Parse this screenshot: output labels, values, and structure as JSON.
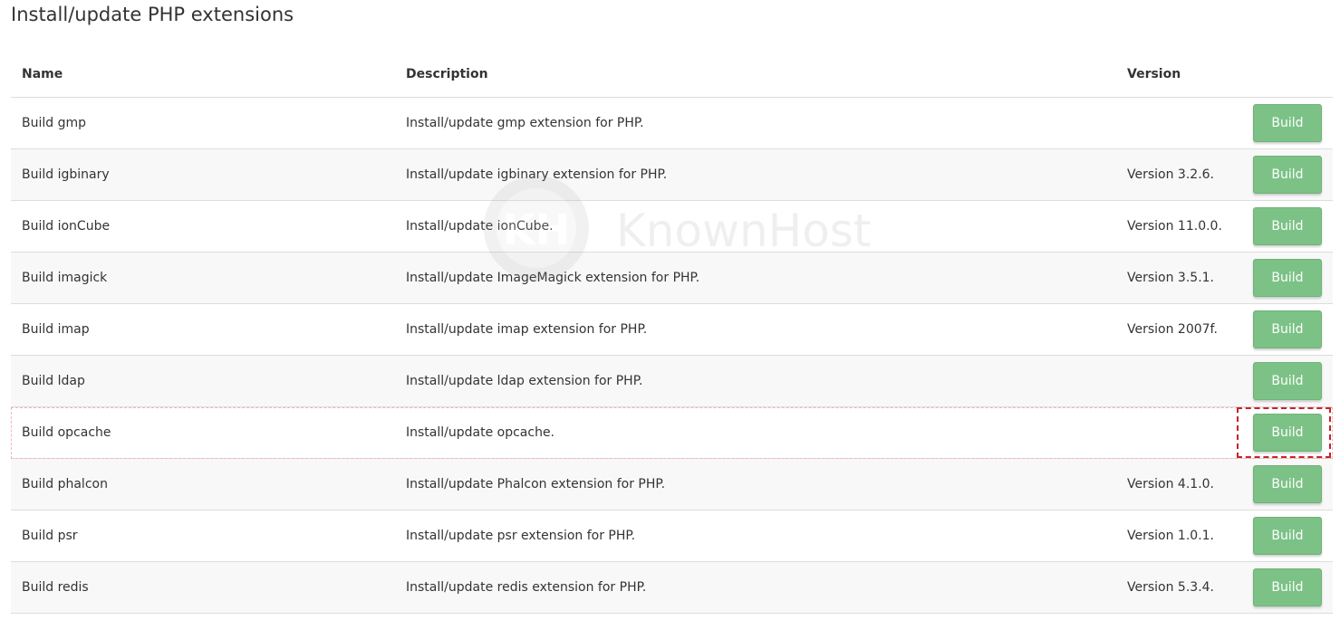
{
  "page": {
    "title": "Install/update PHP extensions"
  },
  "table": {
    "headers": {
      "name": "Name",
      "description": "Description",
      "version": "Version"
    },
    "rows": [
      {
        "name": "Build gmp",
        "description": "Install/update gmp extension for PHP.",
        "version": "",
        "action": "Build"
      },
      {
        "name": "Build igbinary",
        "description": "Install/update igbinary extension for PHP.",
        "version": "Version 3.2.6.",
        "action": "Build"
      },
      {
        "name": "Build ionCube",
        "description": "Install/update ionCube.",
        "version": "Version 11.0.0.",
        "action": "Build"
      },
      {
        "name": "Build imagick",
        "description": "Install/update ImageMagick extension for PHP.",
        "version": "Version 3.5.1.",
        "action": "Build"
      },
      {
        "name": "Build imap",
        "description": "Install/update imap extension for PHP.",
        "version": "Version 2007f.",
        "action": "Build"
      },
      {
        "name": "Build ldap",
        "description": "Install/update ldap extension for PHP.",
        "version": "",
        "action": "Build"
      },
      {
        "name": "Build opcache",
        "description": "Install/update opcache.",
        "version": "",
        "action": "Build",
        "highlighted": true
      },
      {
        "name": "Build phalcon",
        "description": "Install/update Phalcon extension for PHP.",
        "version": "Version 4.1.0.",
        "action": "Build"
      },
      {
        "name": "Build psr",
        "description": "Install/update psr extension for PHP.",
        "version": "Version 1.0.1.",
        "action": "Build"
      },
      {
        "name": "Build redis",
        "description": "Install/update redis extension for PHP.",
        "version": "Version 5.3.4.",
        "action": "Build"
      }
    ]
  },
  "watermark": {
    "monogram": "KH",
    "text": "KnownHost"
  },
  "colors": {
    "button": "#7cc286",
    "highlight_frame": "#c8212a",
    "row_alt": "#f8f8f8",
    "border": "#dddddd"
  }
}
